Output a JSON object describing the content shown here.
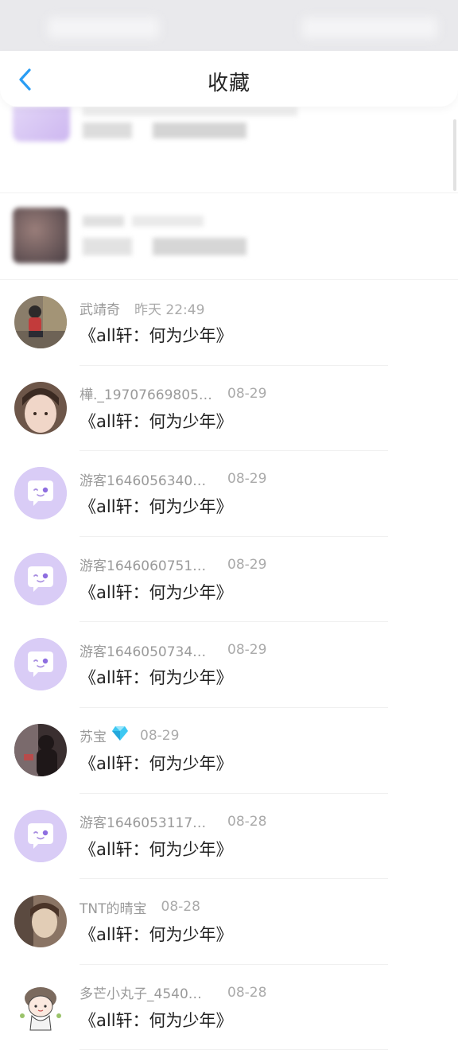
{
  "header": {
    "title": "收藏",
    "back_icon": "chevron-left-icon",
    "accent": "#2a9df4"
  },
  "items": [
    {
      "name": "武靖奇",
      "time": "昨天 22:49",
      "content": "《all轩：何为少年》",
      "avatar": "photo-boy-icon"
    },
    {
      "name": "樺._19707669805…",
      "time": "08-29",
      "content": "《all轩：何为少年》",
      "avatar": "photo-portrait-icon"
    },
    {
      "name": "游客1646056340…",
      "time": "08-29",
      "content": "《all轩：何为少年》",
      "avatar": "chat-bubble-icon"
    },
    {
      "name": "游客1646060751…",
      "time": "08-29",
      "content": "《all轩：何为少年》",
      "avatar": "chat-bubble-icon"
    },
    {
      "name": "游客1646050734…",
      "time": "08-29",
      "content": "《all轩：何为少年》",
      "avatar": "chat-bubble-icon"
    },
    {
      "name": "苏宝",
      "badge": "diamond-icon",
      "time": "08-29",
      "content": "《all轩：何为少年》",
      "avatar": "photo-dark-icon"
    },
    {
      "name": "游客1646053117…",
      "time": "08-28",
      "content": "《all轩：何为少年》",
      "avatar": "chat-bubble-icon"
    },
    {
      "name": "TNT的晴宝",
      "time": "08-28",
      "content": "《all轩：何为少年》",
      "avatar": "photo-sepia-icon"
    },
    {
      "name": "多芒小丸子_4540…",
      "time": "08-28",
      "content": "《all轩：何为少年》",
      "avatar": "cartoon-girl-icon"
    }
  ],
  "colors": {
    "avatar_purple": "#d7c9f5",
    "name_gray": "#9a9a9a",
    "text_dark": "#222222"
  }
}
